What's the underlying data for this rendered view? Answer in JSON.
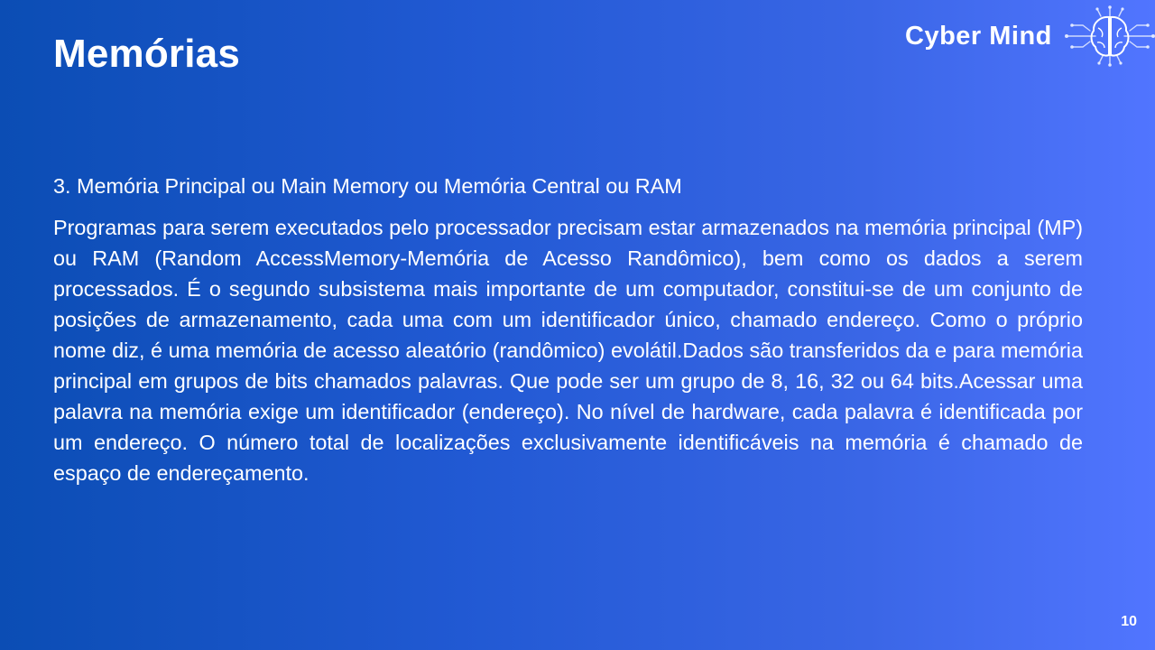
{
  "slide": {
    "title": "Memórias",
    "logo_text": "Cyber Mind",
    "subheading": "3. Memória Principal ou Main Memory ou Memória Central ou RAM",
    "body": "Programas para serem executados pelo processador precisam estar armazenados na memória principal (MP) ou RAM (Random AccessMemory-Memória de Acesso Randômico), bem como os dados a serem processados. É o segundo subsistema mais importante de um computador, constitui-se de um conjunto de posições de armazenamento, cada uma com um identificador único, chamado endereço. Como o próprio nome diz, é uma memória de acesso aleatório (randômico) evolátil.Dados são transferidos da e para memória principal em grupos de bits chamados palavras. Que pode ser um grupo de 8, 16, 32 ou 64 bits.Acessar uma palavra na memória exige um identificador (endereço). No nível de hardware, cada palavra é identificada por um endereço. O número total de localizações exclusivamente identificáveis na memória é chamado de espaço de endereçamento.",
    "page_number": "10"
  },
  "colors": {
    "background_left": "#0b4db4",
    "background_right": "#5175ff",
    "text": "#ffffff",
    "logo_accent": "#e8eeff"
  },
  "icons": {
    "logo": "brain-circuit-icon"
  }
}
